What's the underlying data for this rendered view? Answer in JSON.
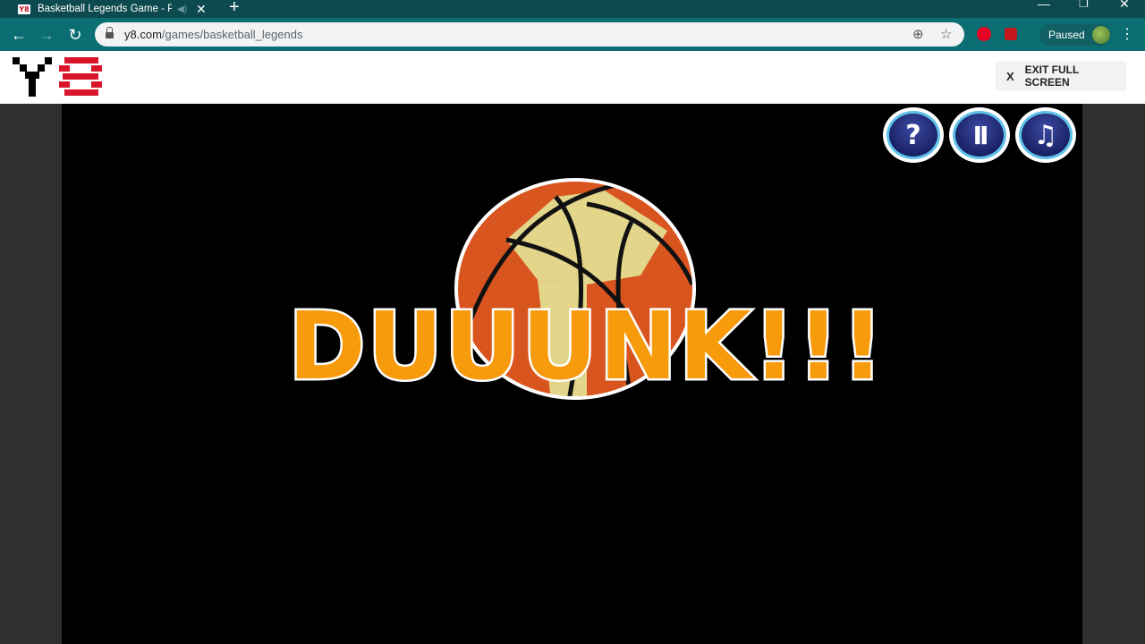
{
  "browser": {
    "tab": {
      "title": "Basketball Legends Game - P",
      "favicon_text": "Y8"
    },
    "address": {
      "host": "y8.com",
      "path": "/games/basketball_legends"
    },
    "profile": {
      "status": "Paused"
    }
  },
  "site": {
    "exit_label": "EXIT FULL SCREEN",
    "exit_x": "X"
  },
  "game": {
    "banner": "DUUUNK!!!",
    "buttons": [
      {
        "name": "help",
        "glyph": "?"
      },
      {
        "name": "pause",
        "glyph": "II"
      },
      {
        "name": "music",
        "glyph": "♫"
      }
    ]
  },
  "colors": {
    "tabstrip": "#0d4a4f",
    "toolbar": "#0a6e72",
    "banner_orange": "#f79a0c",
    "ball_orange": "#d9551f",
    "ball_tan": "#e3d58a",
    "logo_red": "#d9152b"
  }
}
